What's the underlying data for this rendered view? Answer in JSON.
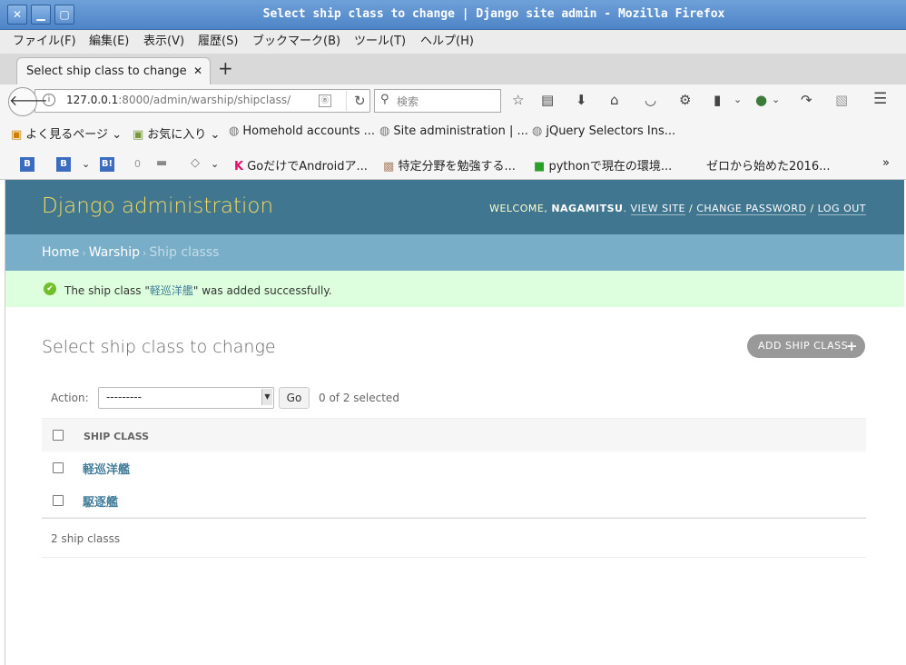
{
  "window": {
    "title": "Select ship class to change | Django site admin - Mozilla Firefox"
  },
  "menubar": {
    "items": [
      "ファイル(F)",
      "編集(E)",
      "表示(V)",
      "履歴(S)",
      "ブックマーク(B)",
      "ツール(T)",
      "ヘルプ(H)"
    ]
  },
  "tab": {
    "label": "Select ship class to change | Django site admin",
    "close": "✕",
    "new_tab": "+"
  },
  "navbar": {
    "url_host": "127.0.0.1",
    "url_rest": ":8000/admin/warship/shipclass/",
    "search_placeholder": "検索"
  },
  "bookmarks": {
    "items": [
      "よく見るページ",
      "お気に入り",
      "Homehold accounts ...",
      "Site administration | ...",
      "jQuery Selectors Ins..."
    ]
  },
  "toolbar3": {
    "hatena_count": "0",
    "items": [
      "GoだけでAndroidア...",
      "特定分野を勉強する...",
      "pythonで現在の環境...",
      "ゼロから始めた2016..."
    ]
  },
  "django": {
    "branding": "Django administration",
    "welcome": "WELCOME,",
    "username": "NAGAMITSU",
    "view_site": "VIEW SITE",
    "change_password": "CHANGE PASSWORD",
    "log_out": "LOG OUT",
    "breadcrumbs": {
      "home": "Home",
      "app": "Warship",
      "current": "Ship classs"
    },
    "message": {
      "prefix": "The ship class \"",
      "link": "軽巡洋艦",
      "suffix": "\" was added successfully."
    },
    "page_title": "Select ship class to change",
    "add_button": "ADD SHIP CLASS",
    "actions": {
      "label": "Action:",
      "selected_value": "---------",
      "go": "Go",
      "counter": "0 of 2 selected"
    },
    "table": {
      "header": "SHIP CLASS",
      "rows": [
        "軽巡洋艦",
        "駆逐艦"
      ]
    },
    "paginator": "2 ship classs"
  },
  "colors": {
    "header_bg": "#417690",
    "breadcrumb_bg": "#79aec8",
    "branding": "#f5dd5d",
    "success_bg": "#ddffdd",
    "link": "#447e9b"
  }
}
